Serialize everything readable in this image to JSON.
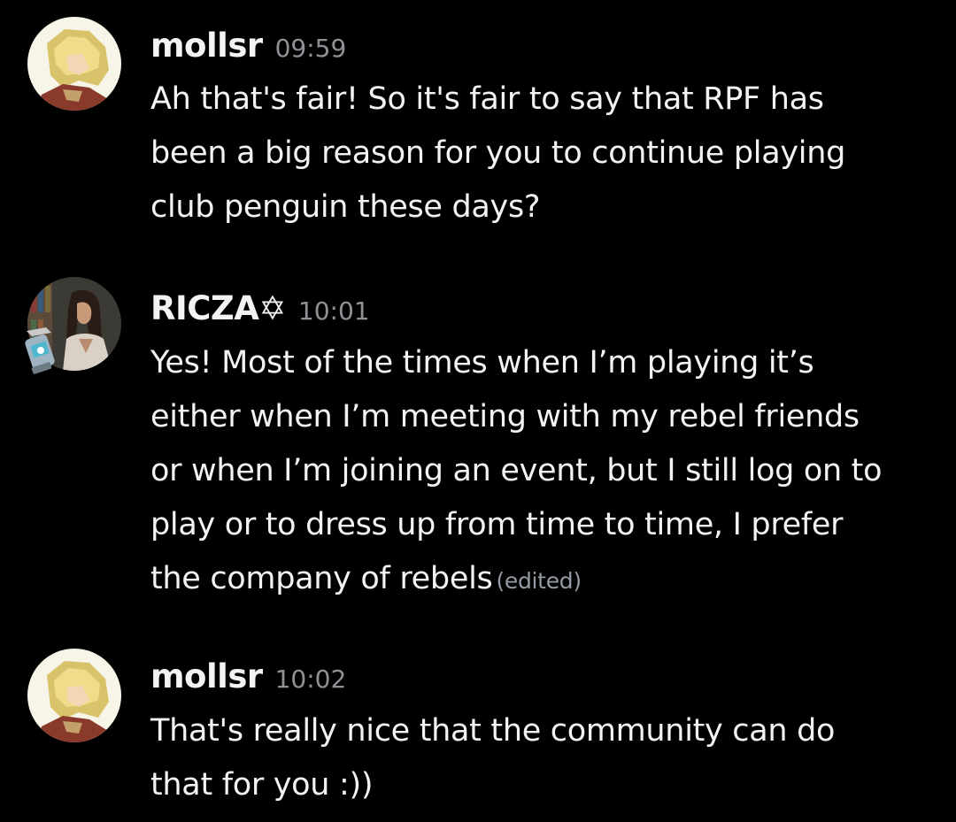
{
  "colors": {
    "background": "#000000",
    "text": "#f2f3f5",
    "muted": "#8e9297"
  },
  "messages": [
    {
      "username": "mollsr",
      "timestamp": "09:59",
      "avatar_icon": "anime-character-avatar-icon",
      "lines": [
        "Ah that's fair! So it's fair to say that RPF has",
        "been a big reason for you to continue playing",
        "club penguin these days?"
      ]
    },
    {
      "username": "RICZA✡︎",
      "timestamp": "10:01",
      "avatar_icon": "character-portrait-avatar-icon",
      "badge_icon": "avatar-decoration-icon",
      "lines": [
        "Yes! Most of the times when I’m playing it’s",
        "either when I’m meeting with my rebel friends",
        "or when I’m joining an event, but I still log on to",
        "play or to dress up from time to time, I prefer",
        "the company of rebels"
      ],
      "edited_label": "(edited)"
    },
    {
      "username": "mollsr",
      "timestamp": "10:02",
      "avatar_icon": "anime-character-avatar-icon",
      "lines": [
        "That's really nice that the community can do",
        "that for you :))"
      ]
    }
  ]
}
